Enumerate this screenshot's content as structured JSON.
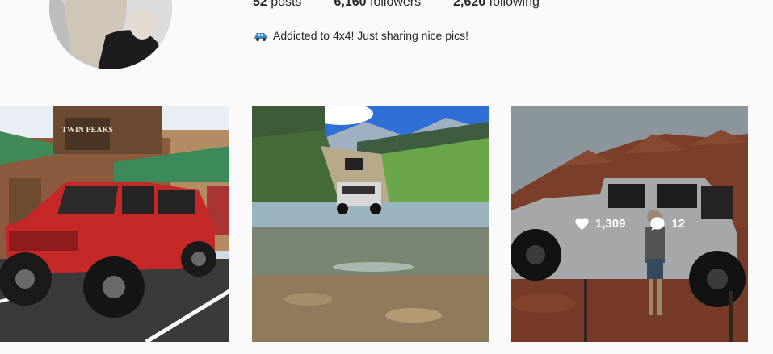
{
  "profile": {
    "posts_count": "52",
    "posts_label": "posts",
    "followers_count": "6,160",
    "followers_label": "followers",
    "following_count": "2,620",
    "following_label": "following",
    "bio_icon": "car-emoji",
    "bio": "Addicted to 4x4! Just sharing nice pics!"
  },
  "posts": [
    {
      "sign_text": "TWIN PEAKS"
    },
    {},
    {
      "hovered": true,
      "likes": "1,309",
      "comments": "12"
    }
  ],
  "colors": {
    "background": "#fafafa",
    "text": "#262626"
  }
}
